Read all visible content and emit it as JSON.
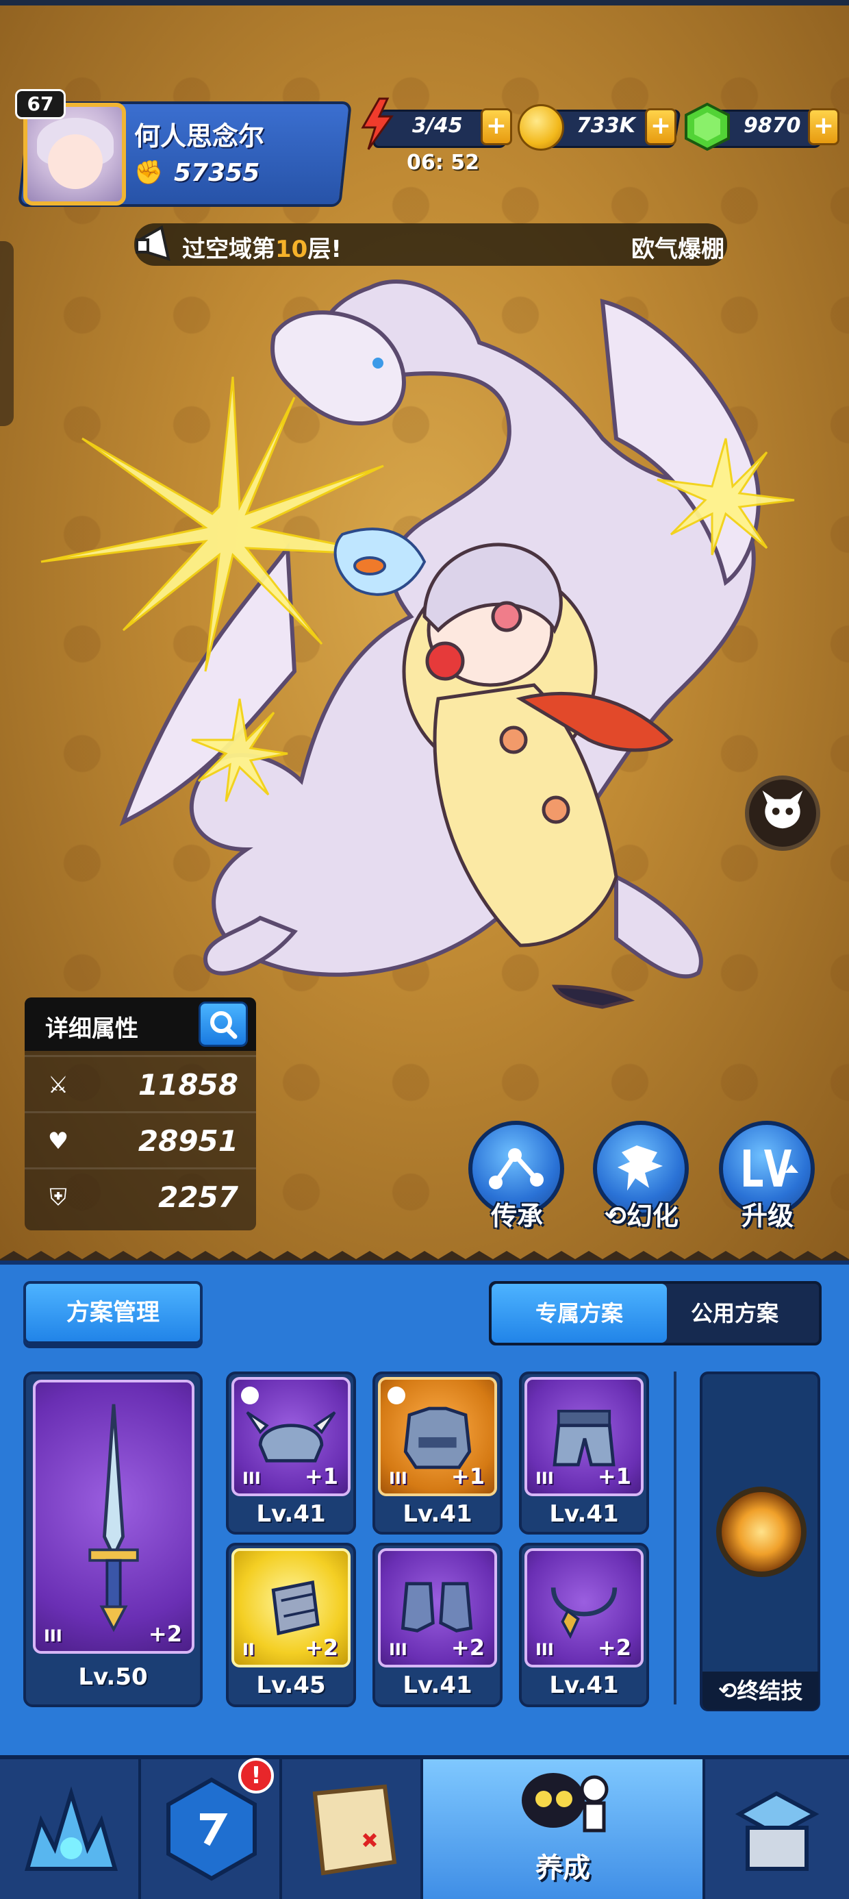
{
  "player": {
    "level": "67",
    "name": "何人思念尔",
    "power": "57355"
  },
  "resources": {
    "energy": "3/45",
    "energy_timer": "06: 52",
    "coins": "733K",
    "gems": "9870",
    "plus": "+"
  },
  "broadcast": {
    "text_before": "过空域第",
    "floor": "10",
    "text_after": "层!",
    "right_text": "欧气爆棚"
  },
  "stats": {
    "title": "详细属性",
    "attack": "11858",
    "hp": "28951",
    "defense": "2257"
  },
  "actions": {
    "inherit": "传承",
    "transform": "幻化",
    "upgrade": "升级"
  },
  "plans": {
    "manage_label": "方案管理",
    "tab_exclusive": "专属方案",
    "tab_public": "公用方案"
  },
  "equipment": {
    "weapon": {
      "tier": "III",
      "plus": "+2",
      "level": "Lv.50"
    },
    "helmet": {
      "tier": "III",
      "plus": "+1",
      "level": "Lv.41"
    },
    "armor": {
      "tier": "III",
      "plus": "+1",
      "level": "Lv.41"
    },
    "pants": {
      "tier": "III",
      "plus": "+1",
      "level": "Lv.41"
    },
    "bracer": {
      "tier": "II",
      "plus": "+2",
      "level": "Lv.45"
    },
    "boots": {
      "tier": "III",
      "plus": "+2",
      "level": "Lv.41"
    },
    "necklace": {
      "tier": "III",
      "plus": "+2",
      "level": "Lv.41"
    }
  },
  "finisher": {
    "label": "终结技"
  },
  "nav": {
    "active_label": "养成",
    "alert": "!"
  },
  "colors": {
    "panel_blue": "#2a7ad8",
    "purple_rarity": "#6a2fb4",
    "orange_rarity": "#d57a14",
    "gold_rarity": "#f4cf24"
  }
}
